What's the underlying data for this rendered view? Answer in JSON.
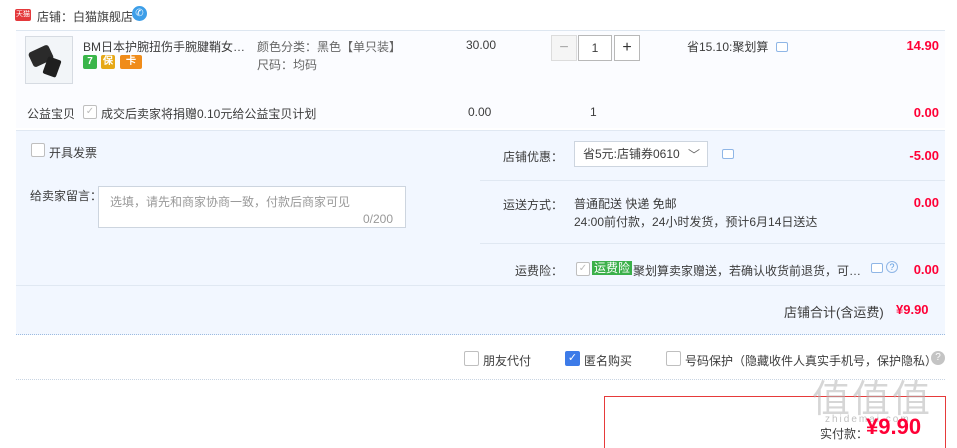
{
  "header": {
    "badge": "天猫",
    "shop_label": "店铺：白猫旗舰店"
  },
  "item": {
    "title": "BM日本护腕扭伤手腕腱鞘女男…",
    "sku_color": "颜色分类：黑色【单只装】",
    "sku_size": "尺码：均码",
    "price": "30.00",
    "quantity": "1",
    "qty_minus": "−",
    "qty_plus": "+",
    "promo": "省15.10:聚划算",
    "subtotal": "14.90",
    "service_icons": [
      "7",
      "保",
      "卡"
    ]
  },
  "charity": {
    "label": "公益宝贝",
    "text": "成交后卖家将捐赠0.10元给公益宝贝计划",
    "price": "0.00",
    "qty": "1",
    "subtotal": "0.00"
  },
  "options": {
    "invoice_label": "开具发票",
    "message_label": "给卖家留言：",
    "message_placeholder": "选填，请先和商家协商一致，付款后商家可见",
    "message_count": "0/200",
    "coupon_label": "店铺优惠：",
    "coupon_value": "省5元:店铺券0610",
    "coupon_amount": "-5.00",
    "shipping_label": "运送方式：",
    "shipping_line1": "普通配送 快递 免邮",
    "shipping_line2": "24:00前付款，24小时发货，预计6月14日送达",
    "shipping_amount": "0.00",
    "insurance_label": "运费险：",
    "insurance_badge": "运费险",
    "insurance_text": "聚划算卖家赠送，若确认收货前退货，可获…",
    "insurance_amount": "0.00"
  },
  "total": {
    "label": "店铺合计(含运费)",
    "amount": "¥9.90"
  },
  "bottom": {
    "friend_pay": "朋友代付",
    "anonymous": "匿名购买",
    "privacy": "号码保护（隐藏收件人真实手机号，保护隐私）",
    "help": "?"
  },
  "pay": {
    "label": "实付款：",
    "amount": "¥9.90"
  },
  "watermark": {
    "text": "值值值",
    "sub": "zhidemai.com"
  },
  "colors": {
    "accent_red": "#ff0036",
    "panel_bg": "#f2f7ff",
    "tmall_red": "#e4393c",
    "checkbox_blue": "#3d7be8"
  }
}
